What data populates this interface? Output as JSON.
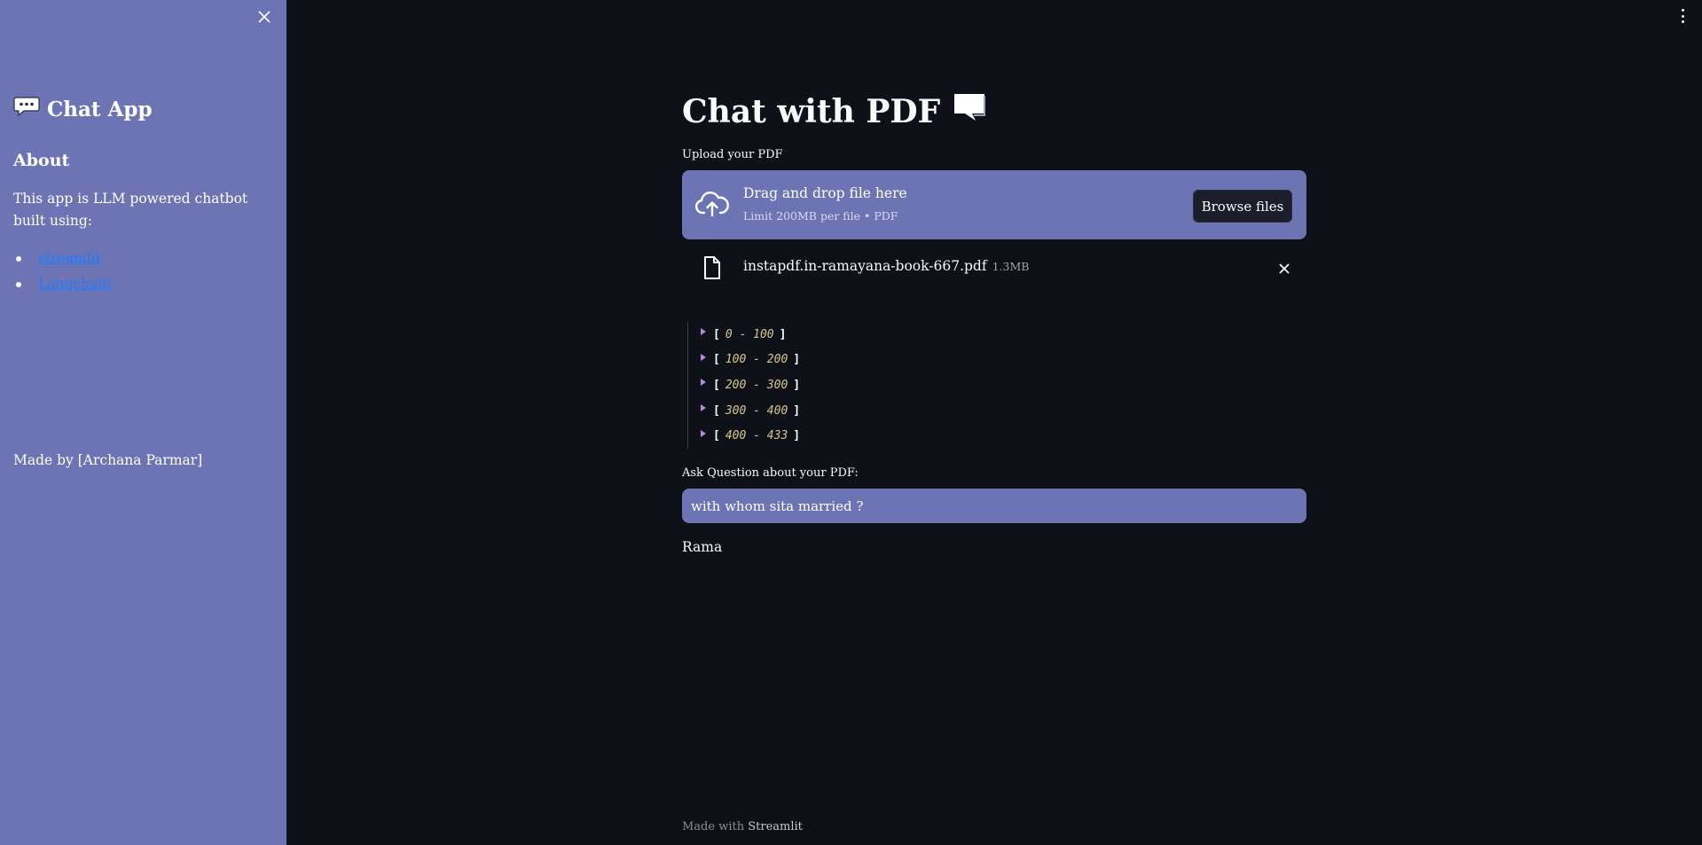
{
  "sidebar": {
    "close_icon": "close-icon",
    "title_icon": "speech-balloon-icon",
    "title": "Chat App",
    "about_heading": "About",
    "description": "This app is LLM powered chatbot built using:",
    "links": [
      {
        "label": "streamlit"
      },
      {
        "label": "Langchain"
      }
    ],
    "made_by": "Made by [Archana Parmar]",
    "bg_color": "#6c74b4",
    "link_color": "#1f7bff"
  },
  "header": {
    "menu_icon": "vertical-dots-menu-icon"
  },
  "main": {
    "title": "Chat with PDF",
    "title_icon": "speech-bubble-icon",
    "upload": {
      "label": "Upload your PDF",
      "drop_text": "Drag and drop file here",
      "limit_text": "Limit 200MB per file • PDF",
      "browse_label": "Browse files"
    },
    "file": {
      "name": "instapdf.in-ramayana-book-667.pdf",
      "size": "1.3MB"
    },
    "chunks": [
      {
        "open": "[",
        "range": "0 - 100",
        "close": "]"
      },
      {
        "open": "[",
        "range": "100 - 200",
        "close": "]"
      },
      {
        "open": "[",
        "range": "200 - 300",
        "close": "]"
      },
      {
        "open": "[",
        "range": "300 - 400",
        "close": "]"
      },
      {
        "open": "[",
        "range": "400 - 433",
        "close": "]"
      }
    ],
    "question": {
      "label": "Ask Question about your PDF:",
      "value": "with whom sita married ?"
    },
    "answer": "Rama"
  },
  "footer": {
    "prefix": "Made with",
    "brand": "Streamlit"
  }
}
